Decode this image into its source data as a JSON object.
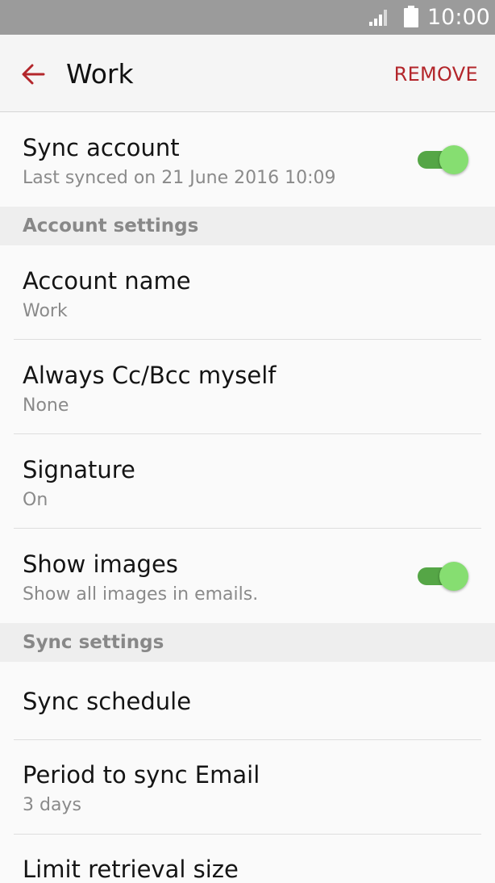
{
  "status_bar": {
    "time": "10:00",
    "icons": [
      "signal-icon",
      "battery-icon"
    ]
  },
  "app_bar": {
    "title": "Work",
    "back_icon": "back-arrow-icon",
    "action_label": "REMOVE"
  },
  "sync_account": {
    "title": "Sync account",
    "subtitle": "Last synced on 21 June 2016  10:09",
    "enabled": true
  },
  "sections": {
    "account_settings": "Account settings",
    "sync_settings": "Sync settings"
  },
  "account_settings": {
    "account_name": {
      "title": "Account name",
      "value": "Work"
    },
    "cc_bcc": {
      "title": "Always Cc/Bcc myself",
      "value": "None"
    },
    "signature": {
      "title": "Signature",
      "value": "On"
    },
    "show_images": {
      "title": "Show images",
      "subtitle": "Show all images in emails.",
      "enabled": true
    }
  },
  "sync_settings": {
    "sync_schedule": {
      "title": "Sync schedule"
    },
    "period_to_sync": {
      "title": "Period to sync Email",
      "value": "3 days"
    },
    "limit_retrieval": {
      "title": "Limit retrieval size"
    }
  },
  "colors": {
    "accent": "#b3262b",
    "toggle_track": "#55a646",
    "toggle_thumb": "#86de71",
    "status_bar": "#9b9b9b"
  }
}
